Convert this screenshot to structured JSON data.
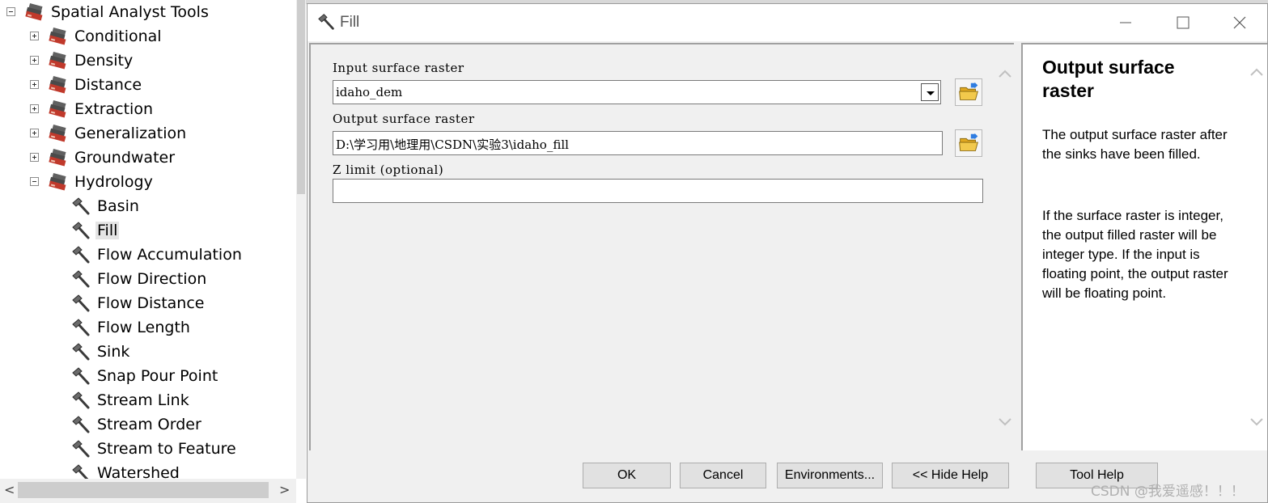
{
  "tree": {
    "root": {
      "label": "Spatial Analyst Tools",
      "expanded": true
    },
    "toolsets": [
      {
        "label": "Conditional",
        "expanded": false
      },
      {
        "label": "Density",
        "expanded": false
      },
      {
        "label": "Distance",
        "expanded": false
      },
      {
        "label": "Extraction",
        "expanded": false
      },
      {
        "label": "Generalization",
        "expanded": false
      },
      {
        "label": "Groundwater",
        "expanded": false
      },
      {
        "label": "Hydrology",
        "expanded": true
      }
    ],
    "hydrology_tools": [
      {
        "label": "Basin"
      },
      {
        "label": "Fill",
        "selected": true
      },
      {
        "label": "Flow Accumulation"
      },
      {
        "label": "Flow Direction"
      },
      {
        "label": "Flow Distance"
      },
      {
        "label": "Flow Length"
      },
      {
        "label": "Sink"
      },
      {
        "label": "Snap Pour Point"
      },
      {
        "label": "Stream Link"
      },
      {
        "label": "Stream Order"
      },
      {
        "label": "Stream to Feature"
      },
      {
        "label": "Watershed"
      }
    ],
    "hscroll": {
      "left_arrow": "<",
      "right_arrow": ">"
    }
  },
  "dialog": {
    "title": "Fill",
    "window_controls": {
      "minimize": "—",
      "maximize": "☐",
      "close": "✕"
    },
    "params": {
      "input_label": "Input surface raster",
      "input_value": "idaho_dem",
      "output_label": "Output surface raster",
      "output_value": "D:\\学习用\\地理用\\CSDN\\实验3\\idaho_fill",
      "zlimit_label": "Z limit (optional)",
      "zlimit_value": ""
    },
    "help": {
      "title": "Output surface raster",
      "p1": "The output surface raster after the sinks have been filled.",
      "p2": "If the surface raster is integer, the output filled raster will be integer type. If the input is floating point, the output raster will be floating point."
    },
    "buttons": {
      "ok": "OK",
      "cancel": "Cancel",
      "environments": "Environments...",
      "hide_help": "<< Hide Help",
      "tool_help": "Tool Help"
    }
  },
  "watermark": "CSDN @我爱遥感！！！",
  "colors": {
    "toolbox_red": "#c0392b",
    "toolbox_gray": "#505050",
    "folder_yellow": "#f2c94c"
  }
}
